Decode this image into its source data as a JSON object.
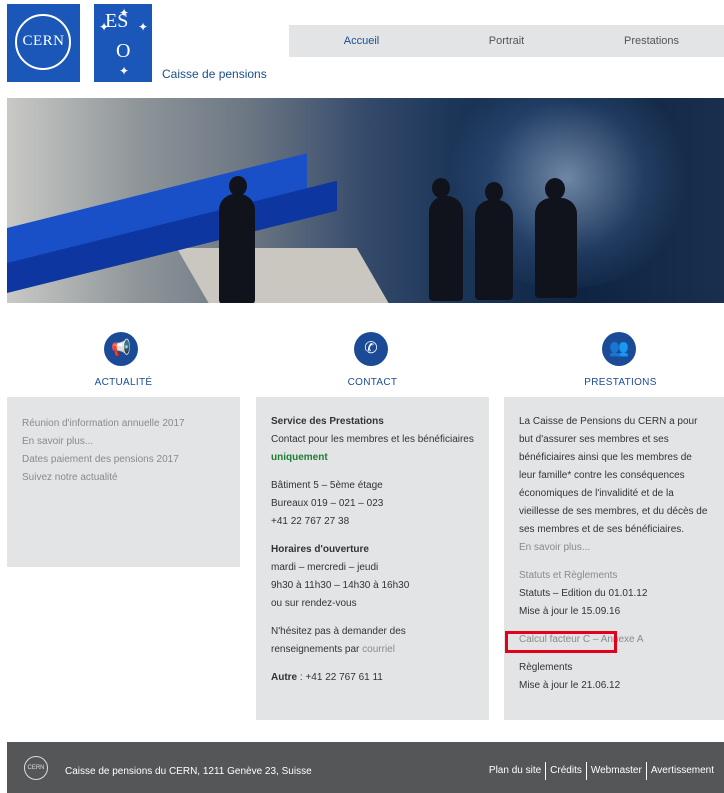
{
  "header": {
    "cern_logo_text": "CERN",
    "eso_logo_es": "ES",
    "eso_logo_o": "O",
    "site_name": "Caisse de pensions"
  },
  "nav": {
    "items": [
      "Accueil",
      "Portrait",
      "Prestations"
    ]
  },
  "sections": {
    "actualite": {
      "title": "ACTUALITÉ",
      "icon": "megaphone-icon",
      "items": [
        "Réunion d'information annuelle 2017",
        "En savoir plus...",
        "Dates paiement des pensions 2017",
        "Suivez notre actualité"
      ]
    },
    "contact": {
      "title": "CONTACT",
      "icon": "phone-icon",
      "service_heading": "Service des Prestations",
      "service_text": "Contact pour les membres et les bénéficiaires",
      "service_emphasis": "uniquement",
      "address_line1": "Bâtiment 5 – 5ème étage",
      "address_line2": "Bureaux 019 – 021 – 023",
      "phone": "+41 22 767 27 38",
      "hours_heading": "Horaires d'ouverture",
      "hours_line1": "mardi – mercredi – jeudi",
      "hours_line2": "9h30 à 11h30 – 14h30 à 16h30",
      "hours_line3": "ou sur rendez-vous",
      "contact_text": "N'hésitez pas à demander des renseignements par",
      "contact_link": "courriel",
      "other_label": "Autre",
      "other_value": " : +41 22 767 61 11"
    },
    "prestations": {
      "title": "PRESTATIONS",
      "icon": "users-icon",
      "intro": "La Caisse de Pensions du CERN a pour but d'assurer ses membres et ses bénéficiaires ainsi que les membres de leur famille* contre les conséquences économiques de l'invalidité et de la vieillesse de ses membres, et du décès de ses membres et de ses bénéficiaires.",
      "more_link": "En savoir plus...",
      "statuts_link": "Statuts et Règlements",
      "statuts_text": "Statuts – Edition du 01.01.12",
      "statuts_update": "Mise à jour le 15.09.16",
      "calcul_link": "Calcul facteur C – Annexe A",
      "reglements_text": "Règlements",
      "reglements_update": "Mise à jour le 21.06.12"
    }
  },
  "footer": {
    "logo_text": "CERN",
    "address": "Caisse de pensions du CERN, 1211 Genève 23, Suisse",
    "links": [
      "Plan du site",
      "Crédits",
      "Webmaster",
      "Avertissement"
    ]
  },
  "colors": {
    "brand_blue": "#1a57b8",
    "nav_background": "#e3e4e6",
    "footer_background": "#555658",
    "highlight_red": "#e3001b"
  }
}
